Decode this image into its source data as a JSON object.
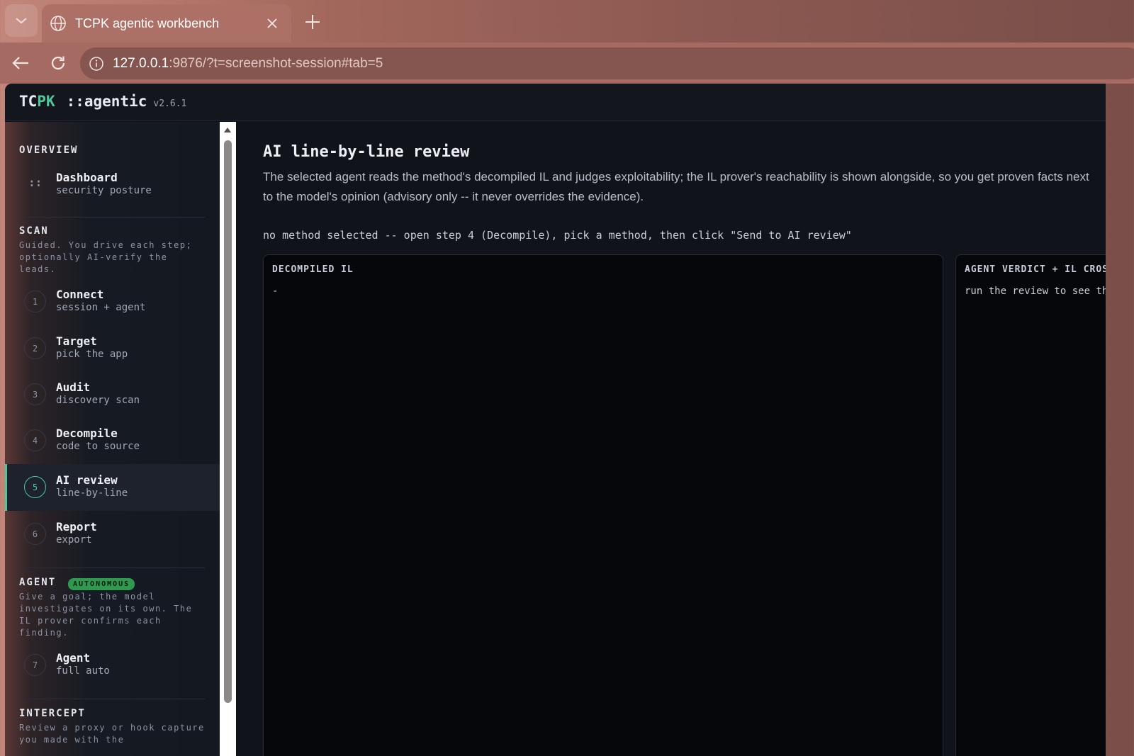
{
  "browser": {
    "tab_title": "TCPK agentic workbench",
    "url_host": "127.0.0.1",
    "url_rest": ":9876/?t=screenshot-session#tab=5"
  },
  "app": {
    "brand_tc": "TC",
    "brand_pk": "PK",
    "brand_name": "::agentic",
    "version": "v2.6.1"
  },
  "sidebar": {
    "overview": {
      "title": "OVERVIEW",
      "items": [
        {
          "glyph": "::",
          "label": "Dashboard",
          "sub": "security posture"
        }
      ]
    },
    "scan": {
      "title": "SCAN",
      "desc": "Guided. You drive each step; optionally AI-verify the leads.",
      "items": [
        {
          "num": "1",
          "label": "Connect",
          "sub": "session + agent"
        },
        {
          "num": "2",
          "label": "Target",
          "sub": "pick the app"
        },
        {
          "num": "3",
          "label": "Audit",
          "sub": "discovery scan"
        },
        {
          "num": "4",
          "label": "Decompile",
          "sub": "code to source"
        },
        {
          "num": "5",
          "label": "AI review",
          "sub": "line-by-line"
        },
        {
          "num": "6",
          "label": "Report",
          "sub": "export"
        }
      ]
    },
    "agent": {
      "title": "AGENT",
      "badge": "AUTONOMOUS",
      "desc": "Give a goal; the model investigates on its own. The IL prover confirms each finding.",
      "items": [
        {
          "num": "7",
          "label": "Agent",
          "sub": "full auto"
        }
      ]
    },
    "intercept": {
      "title": "INTERCEPT",
      "desc": "Review a proxy or hook capture you made with the"
    }
  },
  "main": {
    "title": "AI line-by-line review",
    "description": "The selected agent reads the method's decompiled IL and judges exploitability; the IL prover's reachability is shown alongside, so you get proven facts next to the model's opinion (advisory only -- it never overrides the evidence).",
    "status": "no method selected -- open step 4 (Decompile), pick a method, then click \"Send to AI review\"",
    "panels": {
      "il": {
        "title": "DECOMPILED IL",
        "body": "-"
      },
      "verdict": {
        "title": "AGENT VERDICT + IL CROSS-CHECK",
        "body": "run the review to see the verdict"
      }
    }
  },
  "colors": {
    "accent": "#4fc79b",
    "badge": "#2e9a4f",
    "background": "#10131a"
  }
}
